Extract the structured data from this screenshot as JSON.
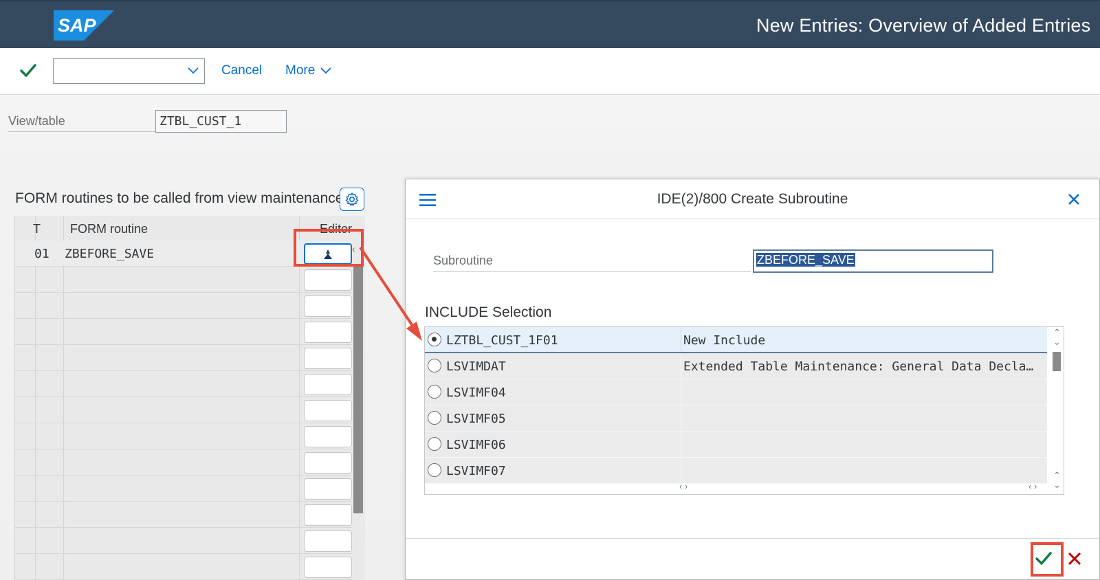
{
  "header": {
    "logo_text": "SAP",
    "title": "New Entries: Overview of Added Entries"
  },
  "toolbar": {
    "dropdown_value": "",
    "cancel_label": "Cancel",
    "more_label": "More"
  },
  "view_table": {
    "label": "View/table",
    "value": "ZTBL_CUST_1"
  },
  "form_table": {
    "title": "FORM routines to be called from view maintenance",
    "columns": [
      "T",
      "FORM routine",
      "Editor"
    ],
    "rows": [
      {
        "t": "01",
        "form_routine": "ZBEFORE_SAVE"
      }
    ]
  },
  "dialog": {
    "title": "IDE(2)/800 Create Subroutine",
    "subroutine_label": "Subroutine",
    "subroutine_value": "ZBEFORE_SAVE",
    "include_title": "INCLUDE Selection",
    "includes": [
      {
        "name": "LZTBL_CUST_1F01",
        "desc": "New Include",
        "selected": true
      },
      {
        "name": "LSVIMDAT",
        "desc": "Extended Table Maintenance: General Data Decla…",
        "selected": false
      },
      {
        "name": "LSVIMF04",
        "desc": "",
        "selected": false
      },
      {
        "name": "LSVIMF05",
        "desc": "",
        "selected": false
      },
      {
        "name": "LSVIMF06",
        "desc": "",
        "selected": false
      },
      {
        "name": "LSVIMF07",
        "desc": "",
        "selected": false
      }
    ]
  },
  "colors": {
    "shell": "#354a5f",
    "link": "#0a6ed1",
    "confirm": "#107e3e",
    "reject": "#bb0000",
    "highlight": "#e74c3c"
  }
}
